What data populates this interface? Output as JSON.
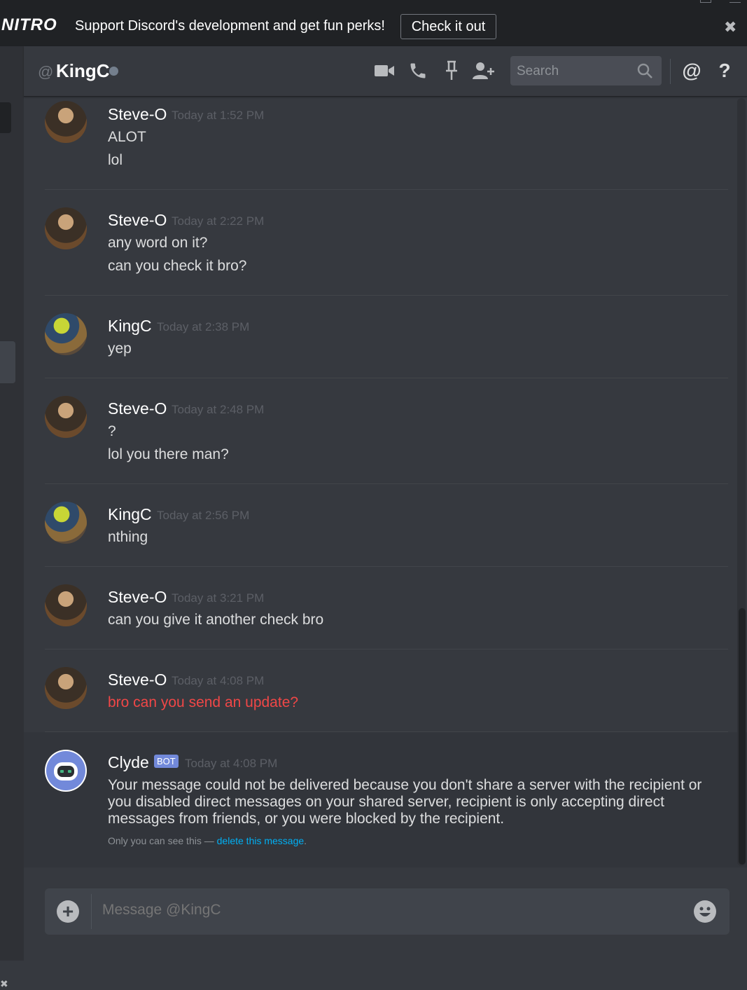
{
  "nitro": {
    "logo": "NITRO",
    "text": "Support Discord's development and get fun perks!",
    "button": "Check it out",
    "close": "✖"
  },
  "header": {
    "at": "@",
    "channel": "KingC",
    "search_placeholder": "Search",
    "mention": "@",
    "help": "?"
  },
  "messages": [
    {
      "user": "Steve-O",
      "time": "Today at 1:52 PM",
      "lines": [
        "ALOT",
        "lol"
      ]
    },
    {
      "user": "Steve-O",
      "time": "Today at 2:22 PM",
      "lines": [
        "any word on it?",
        "can you check it bro?"
      ]
    },
    {
      "user": "KingC",
      "time": "Today at 2:38 PM",
      "lines": [
        "yep"
      ]
    },
    {
      "user": "Steve-O",
      "time": "Today at 2:48 PM",
      "lines": [
        "?",
        "lol you there man?"
      ]
    },
    {
      "user": "KingC",
      "time": "Today at 2:56 PM",
      "lines": [
        "nthing"
      ]
    },
    {
      "user": "Steve-O",
      "time": "Today at 3:21 PM",
      "lines": [
        "can you give it another check bro"
      ]
    },
    {
      "user": "Steve-O",
      "time": "Today at 4:08 PM",
      "lines": [
        "bro can you send an update?"
      ]
    }
  ],
  "clyde": {
    "user": "Clyde",
    "tag": "BOT",
    "time": "Today at 4:08 PM",
    "text": "Your message could not be delivered because you don't share a server with the recipient or you disabled direct messages on your shared server, recipient is only accepting direct messages from friends, or you were blocked by the recipient.",
    "ephemeral_prefix": "Only you can see this — ",
    "delete_link": "delete this message",
    "ephemeral_suffix": "."
  },
  "composer": {
    "placeholder": "Message @KingC",
    "plus": "+"
  },
  "colors": {
    "failed": "#f04747",
    "bot_tag": "#7289da",
    "link": "#00b0f4"
  }
}
